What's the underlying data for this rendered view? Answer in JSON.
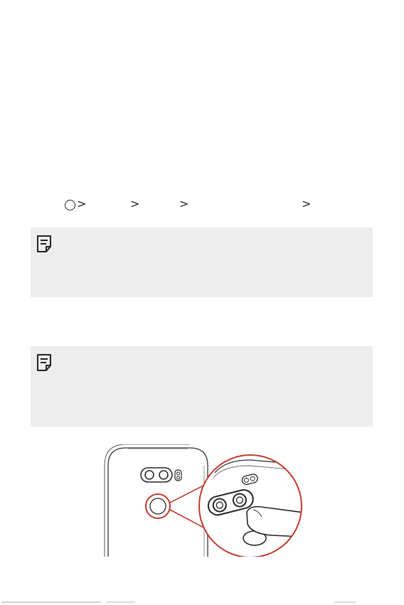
{
  "navigation_path": {
    "separators": [
      ">",
      ">",
      ">",
      ">"
    ],
    "home_icon": "home-circle-icon"
  },
  "notes": [
    {
      "icon": "note-icon"
    },
    {
      "icon": "note-icon"
    }
  ],
  "illustration": {
    "description_icon": "fingerprint-sensor-illustration",
    "highlight_color": "#c0392b"
  },
  "colors": {
    "note_background": "#ededed",
    "text": "#222222",
    "accent": "#c0392b"
  }
}
